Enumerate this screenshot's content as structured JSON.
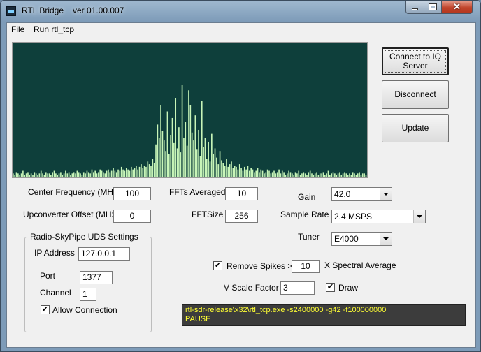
{
  "window": {
    "title": "RTL Bridge",
    "version": "ver 01.00.007"
  },
  "menu": {
    "file": "File",
    "run": "Run rtl_tcp"
  },
  "buttons": {
    "connect": "Connect to IQ Server",
    "disconnect": "Disconnect",
    "update": "Update"
  },
  "settings": {
    "center_frequency_label": "Center Frequency (MHz)",
    "center_frequency_value": "100",
    "upconverter_label": "Upconverter Offset (MHz)",
    "upconverter_value": "0",
    "ffts_averaged_label": "FFTs Averaged",
    "ffts_averaged_value": "10",
    "fftsize_label": "FFTSize",
    "fftsize_value": "256",
    "gain_label": "Gain",
    "gain_value": "42.0",
    "sample_rate_label": "Sample Rate",
    "sample_rate_value": "2.4 MSPS",
    "tuner_label": "Tuner",
    "tuner_value": "E4000",
    "remove_spikes_label": "Remove Spikes >",
    "remove_spikes_checked": true,
    "remove_spikes_value": "10",
    "spectral_average_label": "X Spectral Average",
    "vscale_label": "V Scale Factor",
    "vscale_value": "3",
    "draw_label": "Draw",
    "draw_checked": true
  },
  "uds": {
    "group_title": "Radio-SkyPipe UDS Settings",
    "ip_label": "IP Address",
    "ip_value": "127.0.0.1",
    "port_label": "Port",
    "port_value": "1377",
    "channel_label": "Channel",
    "channel_value": "1",
    "allow_label": "Allow Connection",
    "allow_checked": true
  },
  "console": {
    "line1": "rtl-sdr-release\\x32\\rtl_tcp.exe -s2400000 -g42 -f100000000",
    "line2": "PAUSE"
  },
  "colors": {
    "spectrum_bg": "#0e3f3b",
    "spectrum_bars": "#c8f5b8",
    "console_text": "#ffff33"
  },
  "chart_data": {
    "type": "bar",
    "ylim": [
      0,
      100
    ],
    "values": [
      3,
      2,
      4,
      3,
      2,
      3,
      5,
      2,
      3,
      4,
      2,
      3,
      2,
      4,
      3,
      2,
      3,
      5,
      3,
      2,
      4,
      3,
      3,
      2,
      4,
      5,
      3,
      2,
      3,
      4,
      2,
      3,
      5,
      3,
      4,
      2,
      3,
      4,
      3,
      5,
      4,
      3,
      2,
      4,
      3,
      5,
      4,
      3,
      6,
      4,
      5,
      3,
      4,
      6,
      5,
      4,
      3,
      5,
      6,
      4,
      5,
      7,
      5,
      4,
      6,
      5,
      8,
      6,
      5,
      7,
      6,
      5,
      8,
      6,
      7,
      9,
      6,
      8,
      10,
      7,
      9,
      8,
      12,
      10,
      9,
      14,
      11,
      25,
      40,
      30,
      55,
      35,
      28,
      20,
      50,
      18,
      32,
      45,
      26,
      60,
      22,
      38,
      19,
      70,
      30,
      42,
      24,
      66,
      55,
      34,
      28,
      47,
      21,
      36,
      16,
      58,
      23,
      30,
      14,
      27,
      12,
      33,
      18,
      22,
      15,
      10,
      20,
      13,
      11,
      9,
      14,
      8,
      10,
      12,
      7,
      9,
      8,
      6,
      10,
      7,
      5,
      8,
      6,
      9,
      5,
      7,
      6,
      4,
      5,
      7,
      4,
      6,
      5,
      3,
      4,
      6,
      5,
      3,
      4,
      5,
      3,
      4,
      6,
      3,
      5,
      4,
      2,
      3,
      5,
      4,
      3,
      2,
      4,
      3,
      5,
      2,
      3,
      4,
      3,
      2,
      4,
      5,
      3,
      2,
      3,
      4,
      2,
      3,
      3,
      4,
      2,
      3,
      5,
      2,
      3,
      4,
      3,
      2,
      3,
      4,
      2,
      3,
      4,
      3,
      2,
      3,
      2,
      4,
      3,
      2,
      3,
      4,
      2,
      3,
      3,
      2
    ]
  }
}
